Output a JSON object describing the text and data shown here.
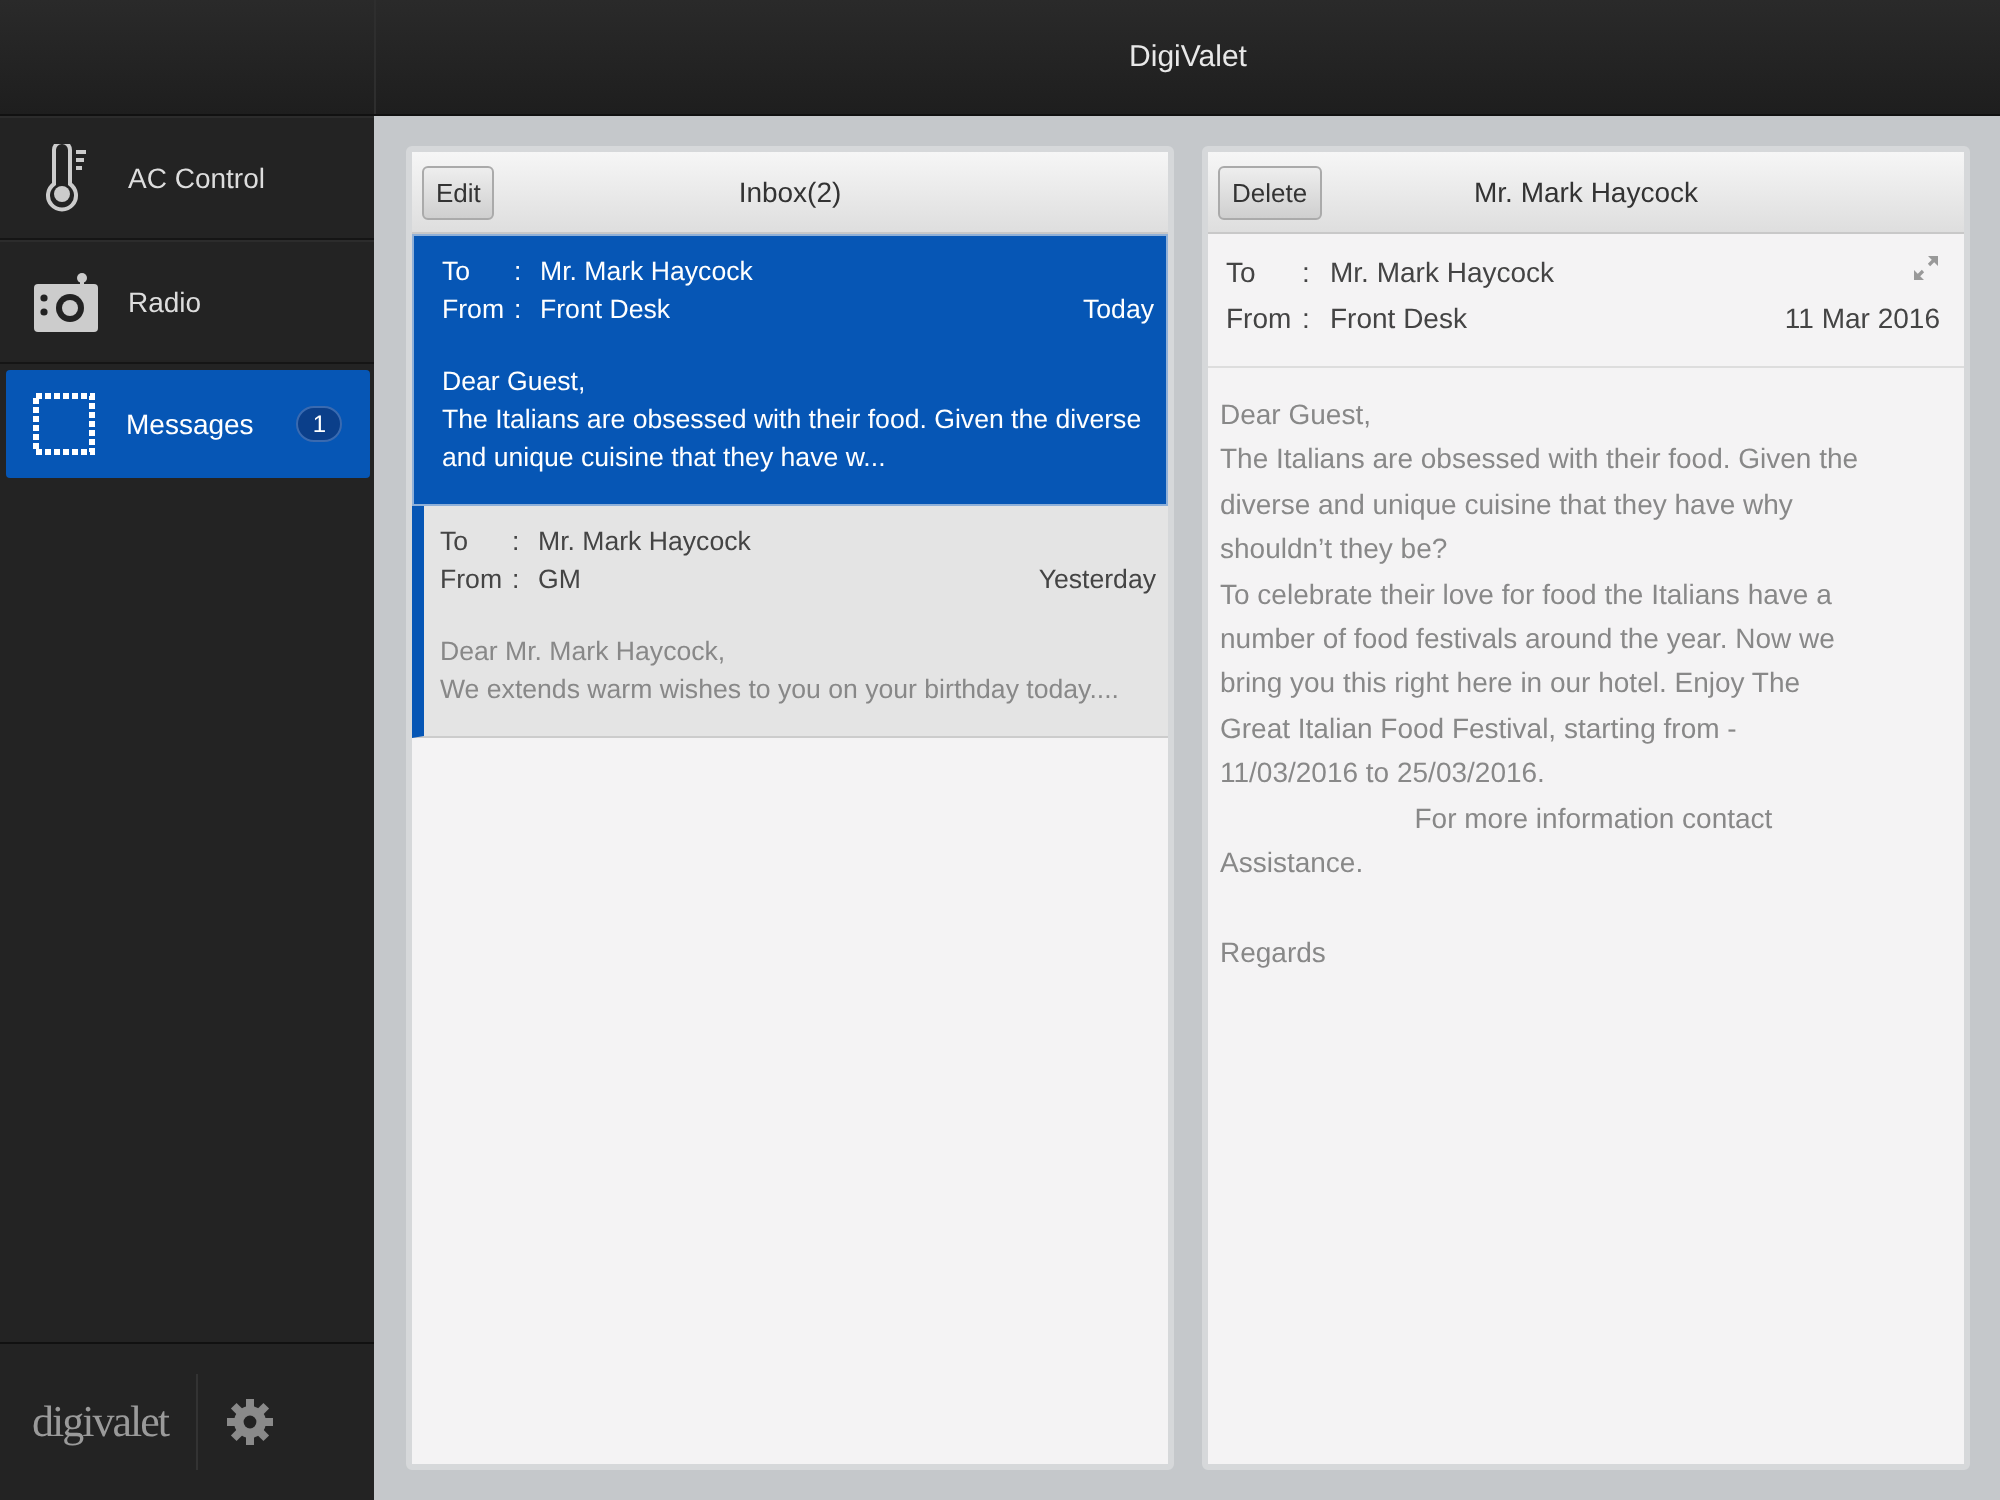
{
  "header": {
    "title": "DigiValet"
  },
  "sidebar": {
    "items": [
      {
        "label": "AC Control",
        "selected": false
      },
      {
        "label": "Radio",
        "selected": false
      },
      {
        "label": "Messages",
        "selected": true,
        "badge": "1"
      }
    ],
    "logo": "digivalet"
  },
  "inbox": {
    "edit_button": "Edit",
    "title": "Inbox(2)",
    "messages": [
      {
        "to_label": "To",
        "to_colon": ":",
        "to": "Mr. Mark Haycock",
        "from_label": "From",
        "from_colon": ":",
        "from": "Front Desk",
        "date": "Today",
        "greeting": "Dear Guest,",
        "preview": "The Italians are obsessed with their food. Given the diverse and unique cuisine that they have w...",
        "selected": true,
        "unread": false
      },
      {
        "to_label": "To",
        "to_colon": ":",
        "to": "Mr. Mark Haycock",
        "from_label": "From",
        "from_colon": ":",
        "from": "GM",
        "date": "Yesterday",
        "greeting": "Dear Mr. Mark Haycock,",
        "preview": "We extends warm wishes to you on your birthday today....",
        "selected": false,
        "unread": true
      }
    ]
  },
  "detail": {
    "delete_button": "Delete",
    "title": "Mr. Mark Haycock",
    "to_label": "To",
    "to_colon": ":",
    "to": "Mr. Mark Haycock",
    "from_label": "From",
    "from_colon": ":",
    "from": "Front Desk",
    "date": "11 Mar 2016",
    "body_lines": [
      "Dear Guest,",
      "The Italians are obsessed with their food. Given the",
      "diverse and unique cuisine that they have why",
      "shouldn’t they be?",
      "To celebrate their love for food the Italians have a",
      "number of food festivals around the year. Now we",
      "bring you this right here in our hotel. Enjoy The",
      "Great Italian Food Festival, starting from -",
      "11/03/2016 to 25/03/2016.",
      "                         For more information contact",
      "Assistance."
    ],
    "closing": "Regards"
  }
}
